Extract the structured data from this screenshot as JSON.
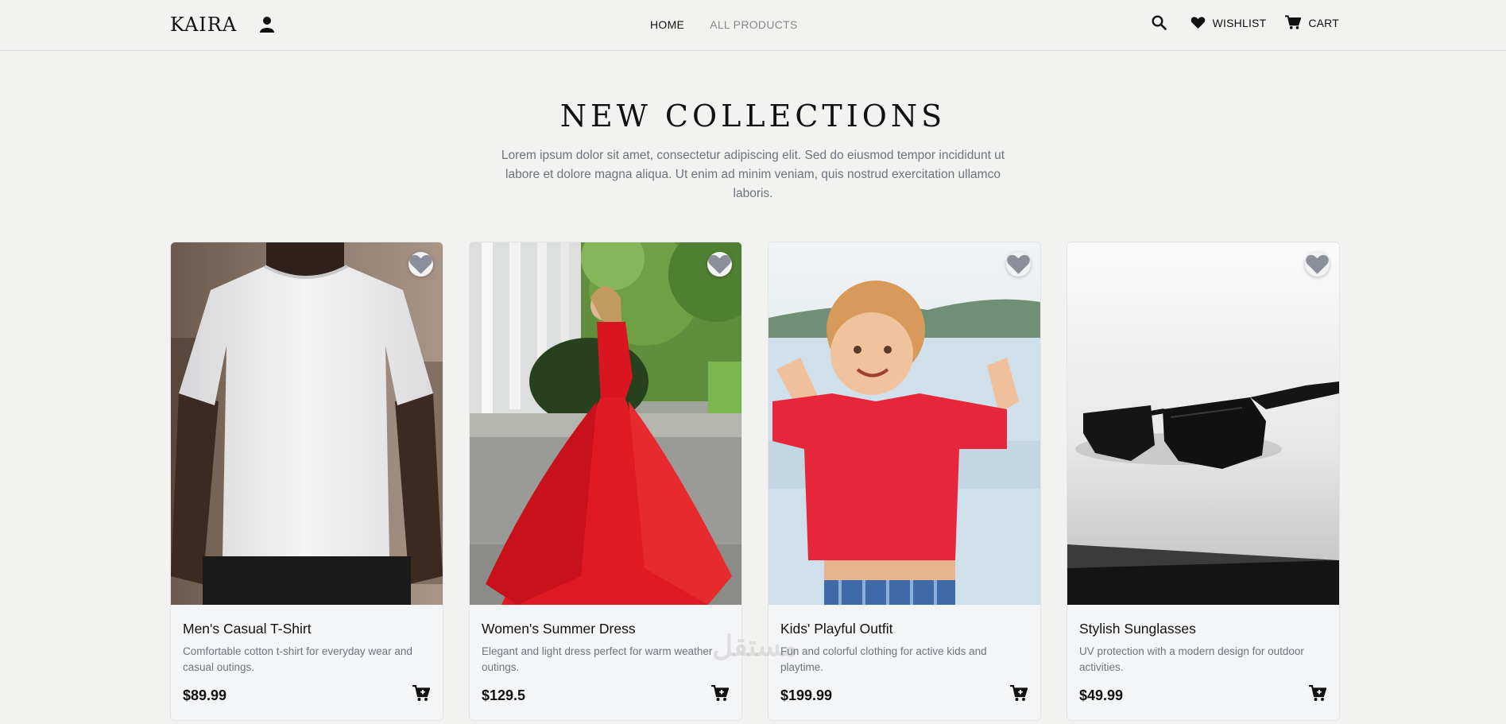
{
  "header": {
    "logo": "KAIRA",
    "nav": [
      {
        "label": "HOME",
        "active": true
      },
      {
        "label": "ALL PRODUCTS",
        "active": false
      }
    ],
    "wishlist_label": "WISHLIST",
    "cart_label": "CART"
  },
  "section": {
    "title": "NEW COLLECTIONS",
    "subtitle": "Lorem ipsum dolor sit amet, consectetur adipiscing elit. Sed do eiusmod tempor incididunt ut labore et dolore magna aliqua. Ut enim ad minim veniam, quis nostrud exercitation ullamco laboris."
  },
  "products": [
    {
      "name": "Men's Casual T-Shirt",
      "description": "Comfortable cotton t-shirt for everyday wear and casual outings.",
      "price": "$89.99",
      "image": "white-tshirt-photo"
    },
    {
      "name": "Women's Summer Dress",
      "description": "Elegant and light dress perfect for warm weather outings.",
      "price": "$129.5",
      "image": "red-dress-photo"
    },
    {
      "name": "Kids' Playful Outfit",
      "description": "Fun and colorful clothing for active kids and playtime.",
      "price": "$199.99",
      "image": "kid-red-shirt-photo"
    },
    {
      "name": "Stylish Sunglasses",
      "description": "UV protection with a modern design for outdoor activities.",
      "price": "$49.99",
      "image": "sunglasses-photo"
    }
  ],
  "watermark": "مستقل",
  "colors": {
    "background": "#f2f2f0",
    "card": "#f4f5f7",
    "text": "#111111",
    "muted": "#6c757d",
    "heart": "#8a8f99"
  }
}
